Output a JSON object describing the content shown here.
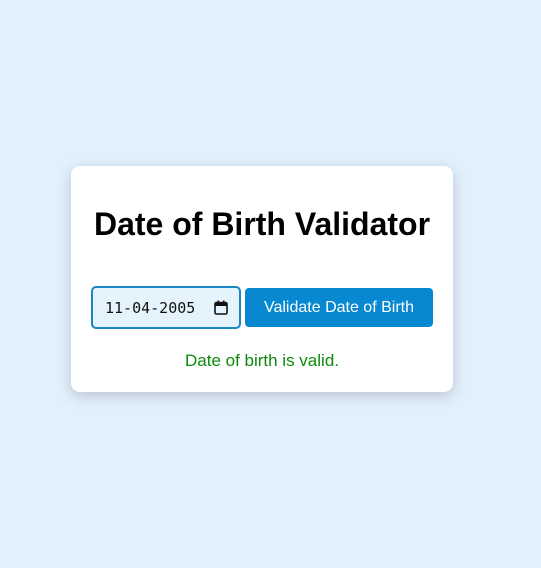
{
  "page": {
    "title": "Date of Birth Validator"
  },
  "form": {
    "date_value": "11-04-2005",
    "date_icon": "calendar-icon",
    "validate_label": "Validate Date of Birth"
  },
  "result": {
    "message": "Date of birth is valid."
  },
  "colors": {
    "background": "#e2f0fc",
    "accent": "#0788d0",
    "success": "#0a8a0a",
    "input_border": "#1a86c4",
    "input_background": "#e4f3fc"
  }
}
